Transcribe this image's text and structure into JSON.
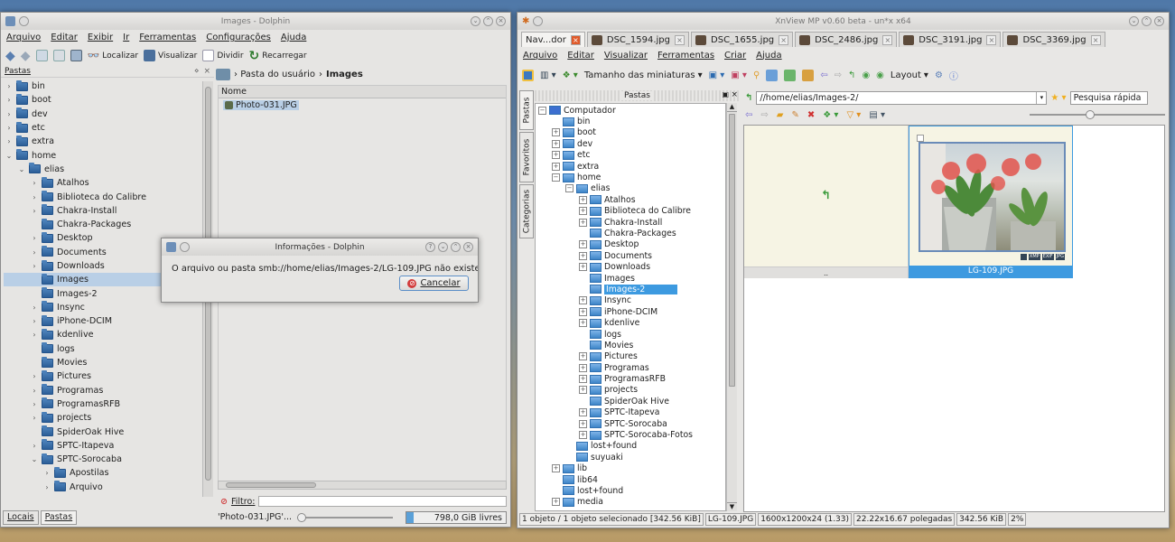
{
  "dolphin": {
    "title": "Images - Dolphin",
    "menu": [
      "Arquivo",
      "Editar",
      "Exibir",
      "Ir",
      "Ferramentas",
      "Configurações",
      "Ajuda"
    ],
    "toolbar": {
      "find": "Localizar",
      "preview": "Visualizar",
      "split": "Dividir",
      "reload": "Recarregar"
    },
    "panel_title": "Pastas",
    "breadcrumb": {
      "home": "Pasta do usuário",
      "current": "Images"
    },
    "column_header": "Nome",
    "files": [
      "Photo-031.JPG"
    ],
    "tree": [
      {
        "label": "bin",
        "depth": 0,
        "arrow": ">"
      },
      {
        "label": "boot",
        "depth": 0,
        "arrow": ">"
      },
      {
        "label": "dev",
        "depth": 0,
        "arrow": ">"
      },
      {
        "label": "etc",
        "depth": 0,
        "arrow": ">"
      },
      {
        "label": "extra",
        "depth": 0,
        "arrow": ">"
      },
      {
        "label": "home",
        "depth": 0,
        "arrow": "v"
      },
      {
        "label": "elias",
        "depth": 1,
        "arrow": "v"
      },
      {
        "label": "Atalhos",
        "depth": 2,
        "arrow": ">"
      },
      {
        "label": "Biblioteca do Calibre",
        "depth": 2,
        "arrow": ">"
      },
      {
        "label": "Chakra-Install",
        "depth": 2,
        "arrow": ">"
      },
      {
        "label": "Chakra-Packages",
        "depth": 2,
        "arrow": ""
      },
      {
        "label": "Desktop",
        "depth": 2,
        "arrow": ">"
      },
      {
        "label": "Documents",
        "depth": 2,
        "arrow": ">"
      },
      {
        "label": "Downloads",
        "depth": 2,
        "arrow": ">"
      },
      {
        "label": "Images",
        "depth": 2,
        "arrow": "",
        "selected": true
      },
      {
        "label": "Images-2",
        "depth": 2,
        "arrow": ""
      },
      {
        "label": "Insync",
        "depth": 2,
        "arrow": ">"
      },
      {
        "label": "iPhone-DCIM",
        "depth": 2,
        "arrow": ">"
      },
      {
        "label": "kdenlive",
        "depth": 2,
        "arrow": ">"
      },
      {
        "label": "logs",
        "depth": 2,
        "arrow": ""
      },
      {
        "label": "Movies",
        "depth": 2,
        "arrow": ""
      },
      {
        "label": "Pictures",
        "depth": 2,
        "arrow": ">"
      },
      {
        "label": "Programas",
        "depth": 2,
        "arrow": ">"
      },
      {
        "label": "ProgramasRFB",
        "depth": 2,
        "arrow": ">"
      },
      {
        "label": "projects",
        "depth": 2,
        "arrow": ">"
      },
      {
        "label": "SpiderOak Hive",
        "depth": 2,
        "arrow": ""
      },
      {
        "label": "SPTC-Itapeva",
        "depth": 2,
        "arrow": ">"
      },
      {
        "label": "SPTC-Sorocaba",
        "depth": 2,
        "arrow": "v"
      },
      {
        "label": "Apostilas",
        "depth": 3,
        "arrow": ">"
      },
      {
        "label": "Arquivo",
        "depth": 3,
        "arrow": ">"
      }
    ],
    "bottom_tabs": [
      "Locais",
      "Pastas"
    ],
    "filter_label": "Filtro:",
    "status_file": "'Photo-031.JPG'...",
    "free_space": "798,0 GiB livres"
  },
  "dialog": {
    "title": "Informações - Dolphin",
    "message": "O arquivo ou pasta smb://home/elias/Images-2/LG-109.JPG não existe.",
    "cancel": "Cancelar"
  },
  "xnview": {
    "title": "XnView MP v0.60 beta - un*x x64",
    "tabs": [
      "Nav...dor",
      "DSC_1594.jpg",
      "DSC_1655.jpg",
      "DSC_2486.jpg",
      "DSC_3191.jpg",
      "DSC_3369.jpg"
    ],
    "menu": [
      "Arquivo",
      "Editar",
      "Visualizar",
      "Ferramentas",
      "Criar",
      "Ajuda"
    ],
    "toolbar": {
      "thumb_size": "Tamanho das miniaturas",
      "layout": "Layout"
    },
    "panel_title": "Pastas",
    "side_tabs": [
      "Pastas",
      "Favoritos",
      "Categorias"
    ],
    "path": "//home/elias/Images-2/",
    "search_placeholder": "Pesquisa rápida",
    "tree": [
      {
        "label": "Computador",
        "depth": 0,
        "exp": "-"
      },
      {
        "label": "bin",
        "depth": 1,
        "exp": ""
      },
      {
        "label": "boot",
        "depth": 1,
        "exp": "+"
      },
      {
        "label": "dev",
        "depth": 1,
        "exp": "+"
      },
      {
        "label": "etc",
        "depth": 1,
        "exp": "+"
      },
      {
        "label": "extra",
        "depth": 1,
        "exp": "+"
      },
      {
        "label": "home",
        "depth": 1,
        "exp": "-"
      },
      {
        "label": "elias",
        "depth": 2,
        "exp": "-"
      },
      {
        "label": "Atalhos",
        "depth": 3,
        "exp": "+"
      },
      {
        "label": "Biblioteca do Calibre",
        "depth": 3,
        "exp": "+"
      },
      {
        "label": "Chakra-Install",
        "depth": 3,
        "exp": "+"
      },
      {
        "label": "Chakra-Packages",
        "depth": 3,
        "exp": ""
      },
      {
        "label": "Desktop",
        "depth": 3,
        "exp": "+"
      },
      {
        "label": "Documents",
        "depth": 3,
        "exp": "+"
      },
      {
        "label": "Downloads",
        "depth": 3,
        "exp": "+"
      },
      {
        "label": "Images",
        "depth": 3,
        "exp": ""
      },
      {
        "label": "Images-2",
        "depth": 3,
        "exp": "",
        "selected": true
      },
      {
        "label": "Insync",
        "depth": 3,
        "exp": "+"
      },
      {
        "label": "iPhone-DCIM",
        "depth": 3,
        "exp": "+"
      },
      {
        "label": "kdenlive",
        "depth": 3,
        "exp": "+"
      },
      {
        "label": "logs",
        "depth": 3,
        "exp": ""
      },
      {
        "label": "Movies",
        "depth": 3,
        "exp": ""
      },
      {
        "label": "Pictures",
        "depth": 3,
        "exp": "+"
      },
      {
        "label": "Programas",
        "depth": 3,
        "exp": "+"
      },
      {
        "label": "ProgramasRFB",
        "depth": 3,
        "exp": "+"
      },
      {
        "label": "projects",
        "depth": 3,
        "exp": "+"
      },
      {
        "label": "SpiderOak Hive",
        "depth": 3,
        "exp": ""
      },
      {
        "label": "SPTC-Itapeva",
        "depth": 3,
        "exp": "+"
      },
      {
        "label": "SPTC-Sorocaba",
        "depth": 3,
        "exp": "+"
      },
      {
        "label": "SPTC-Sorocaba-Fotos",
        "depth": 3,
        "exp": "+"
      },
      {
        "label": "lost+found",
        "depth": 2,
        "exp": ""
      },
      {
        "label": "suyuaki",
        "depth": 2,
        "exp": ""
      },
      {
        "label": "lib",
        "depth": 1,
        "exp": "+"
      },
      {
        "label": "lib64",
        "depth": 1,
        "exp": ""
      },
      {
        "label": "lost+found",
        "depth": 1,
        "exp": ""
      },
      {
        "label": "media",
        "depth": 1,
        "exp": "+"
      }
    ],
    "thumbs": [
      {
        "label": "..",
        "kind": "parent"
      },
      {
        "label": "LG-109.JPG",
        "kind": "image",
        "badges": [
          "JPG",
          "EXIF",
          "XMP"
        ]
      }
    ],
    "status": [
      "1 objeto / 1 objeto selecionado [342.56 KiB]",
      "LG-109.JPG",
      "1600x1200x24 (1.33)",
      "22.22x16.67 polegadas",
      "342.56 KiB",
      "2%"
    ]
  }
}
